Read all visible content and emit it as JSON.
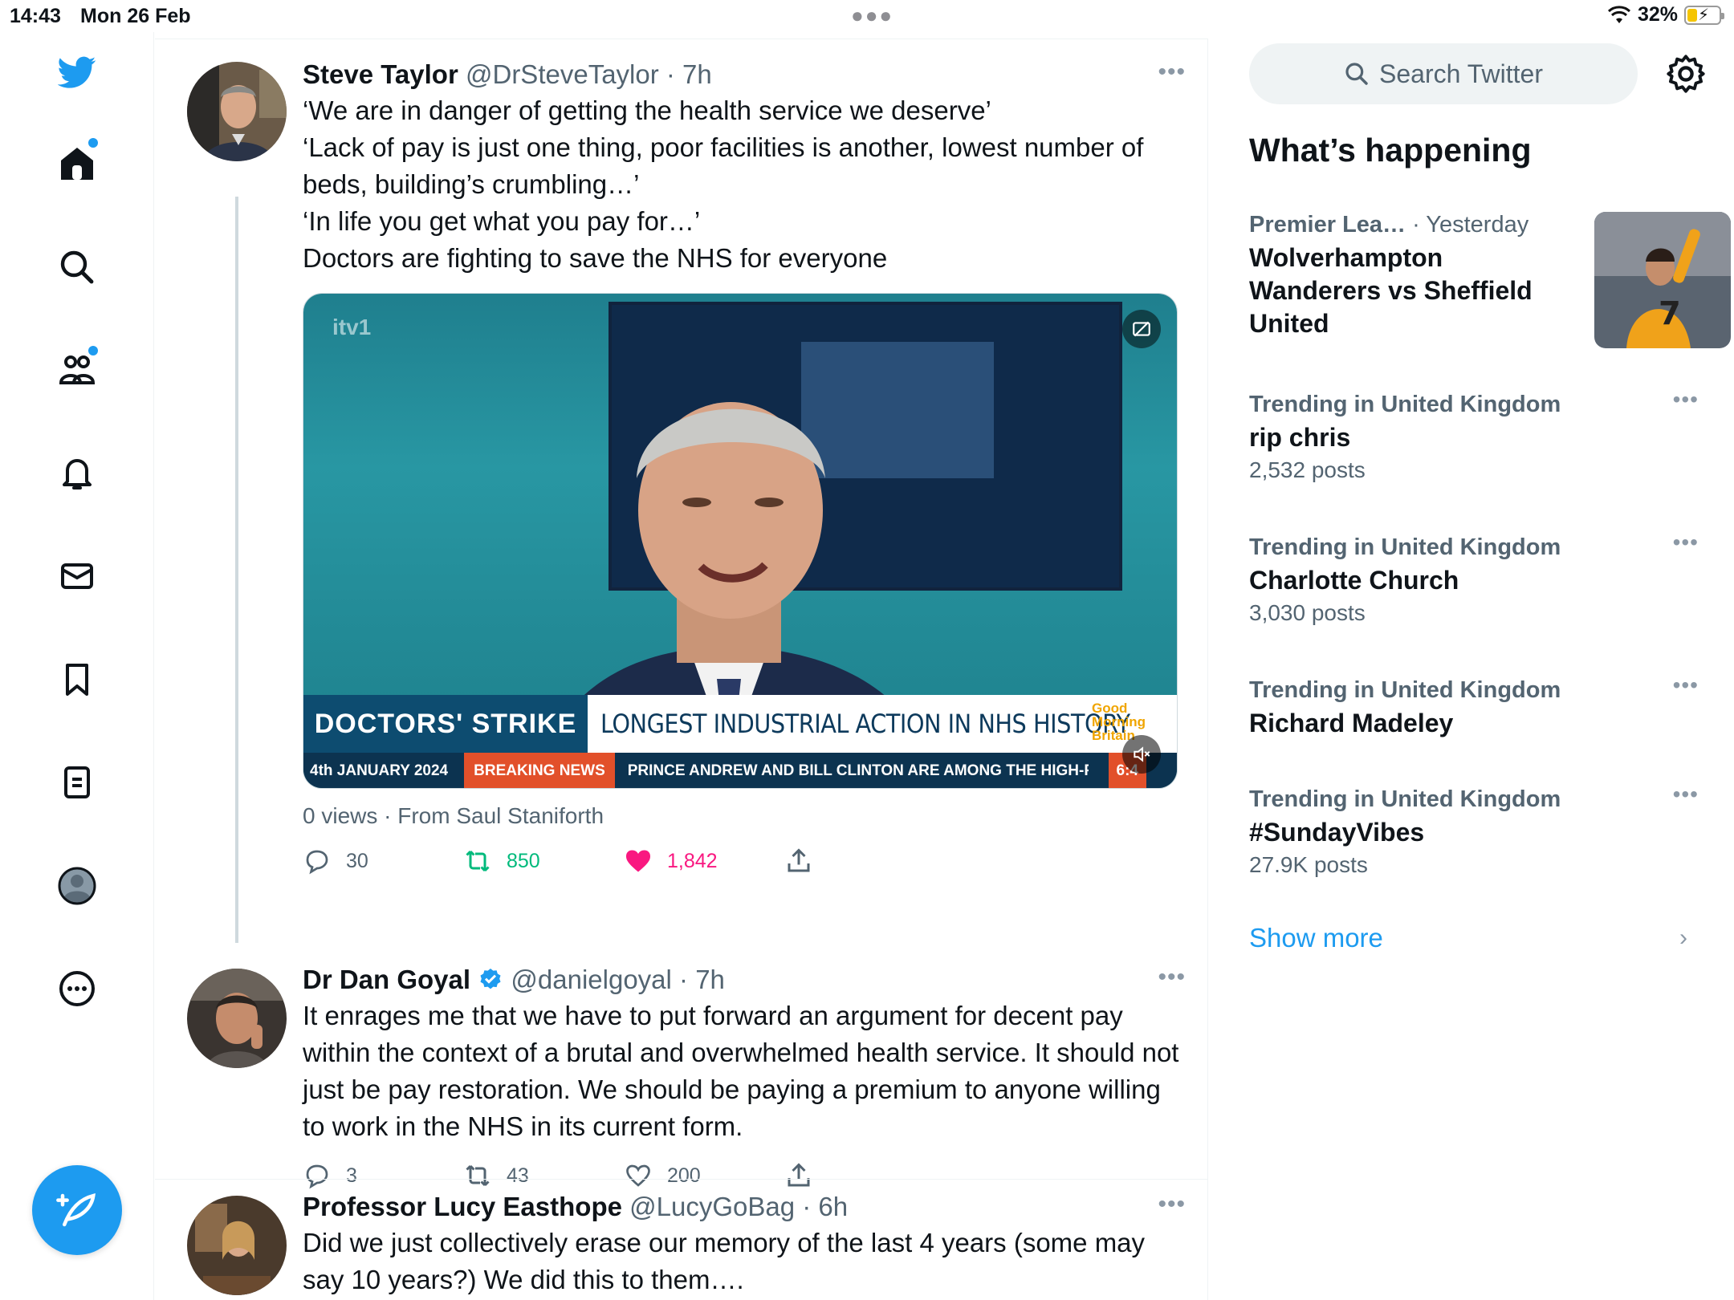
{
  "status_bar": {
    "time": "14:43",
    "date": "Mon 26 Feb",
    "battery_percent": "32%",
    "battery_level": 0.32
  },
  "nav": {
    "items": [
      "home-icon",
      "search-icon",
      "communities-icon",
      "notifications-icon",
      "messages-icon",
      "bookmarks-icon",
      "lists-icon",
      "profile-icon",
      "more-icon"
    ]
  },
  "tweets": [
    {
      "name": "Steve Taylor",
      "handle": "@DrSteveTaylor",
      "time": "· 7h",
      "lines": [
        "‘We are in danger of getting the health service we deserve’",
        "‘Lack of pay is just one thing, poor facilities is another, lowest number of beds, building’s crumbling…’",
        "‘In life you get what you pay for…’",
        "Doctors are fighting to save the NHS for everyone"
      ],
      "media": {
        "channel_logo": "itv1",
        "strap_left": "DOCTORS' STRIKE",
        "headline": "LONGEST INDUSTRIAL ACTION IN NHS HISTORY",
        "programme": "Good Morning Britain",
        "ticker_date": "4th JANUARY 2024",
        "ticker_tag": "BREAKING NEWS",
        "ticker_text": "PRINCE ANDREW AND BILL CLINTON ARE AMONG THE HIGH-PROF",
        "ticker_time": "6:4"
      },
      "meta": "0 views · From Saul Staniforth",
      "replies": "30",
      "retweets": "850",
      "likes": "1,842"
    },
    {
      "name": "Dr Dan Goyal",
      "handle": "@danielgoyal",
      "time": "· 7h",
      "text": "It enrages me that we have to put forward an argument for decent pay within the context of a brutal and overwhelmed health service. It should not just be pay restoration. We should be paying a premium to anyone willing to work in the NHS in its current form.",
      "replies": "3",
      "retweets": "43",
      "likes": "200"
    },
    {
      "name": "Professor Lucy Easthope",
      "handle": "@LucyGoBag",
      "time": "· 6h",
      "text": "Did we just collectively erase our memory of the last 4 years (some may say 10 years?) We did this to them…."
    }
  ],
  "sidebar": {
    "search_placeholder": "Search Twitter",
    "title": "What’s happening",
    "trends": [
      {
        "context": "Premier Lea…",
        "when": "· Yesterday",
        "title": "Wolverhampton Wanderers vs Sheffield United"
      },
      {
        "context": "Trending in United Kingdom",
        "title": "rip chris",
        "count": "2,532 posts"
      },
      {
        "context": "Trending in United Kingdom",
        "title": "Charlotte Church",
        "count": "3,030 posts"
      },
      {
        "context": "Trending in United Kingdom",
        "title": "Richard Madeley"
      },
      {
        "context": "Trending in United Kingdom",
        "title": "#SundayVibes",
        "count": "27.9K posts"
      }
    ],
    "show_more": "Show more"
  },
  "colors": {
    "accent": "#1d9bf0",
    "like": "#f91880",
    "retweet": "#00ba7c"
  }
}
